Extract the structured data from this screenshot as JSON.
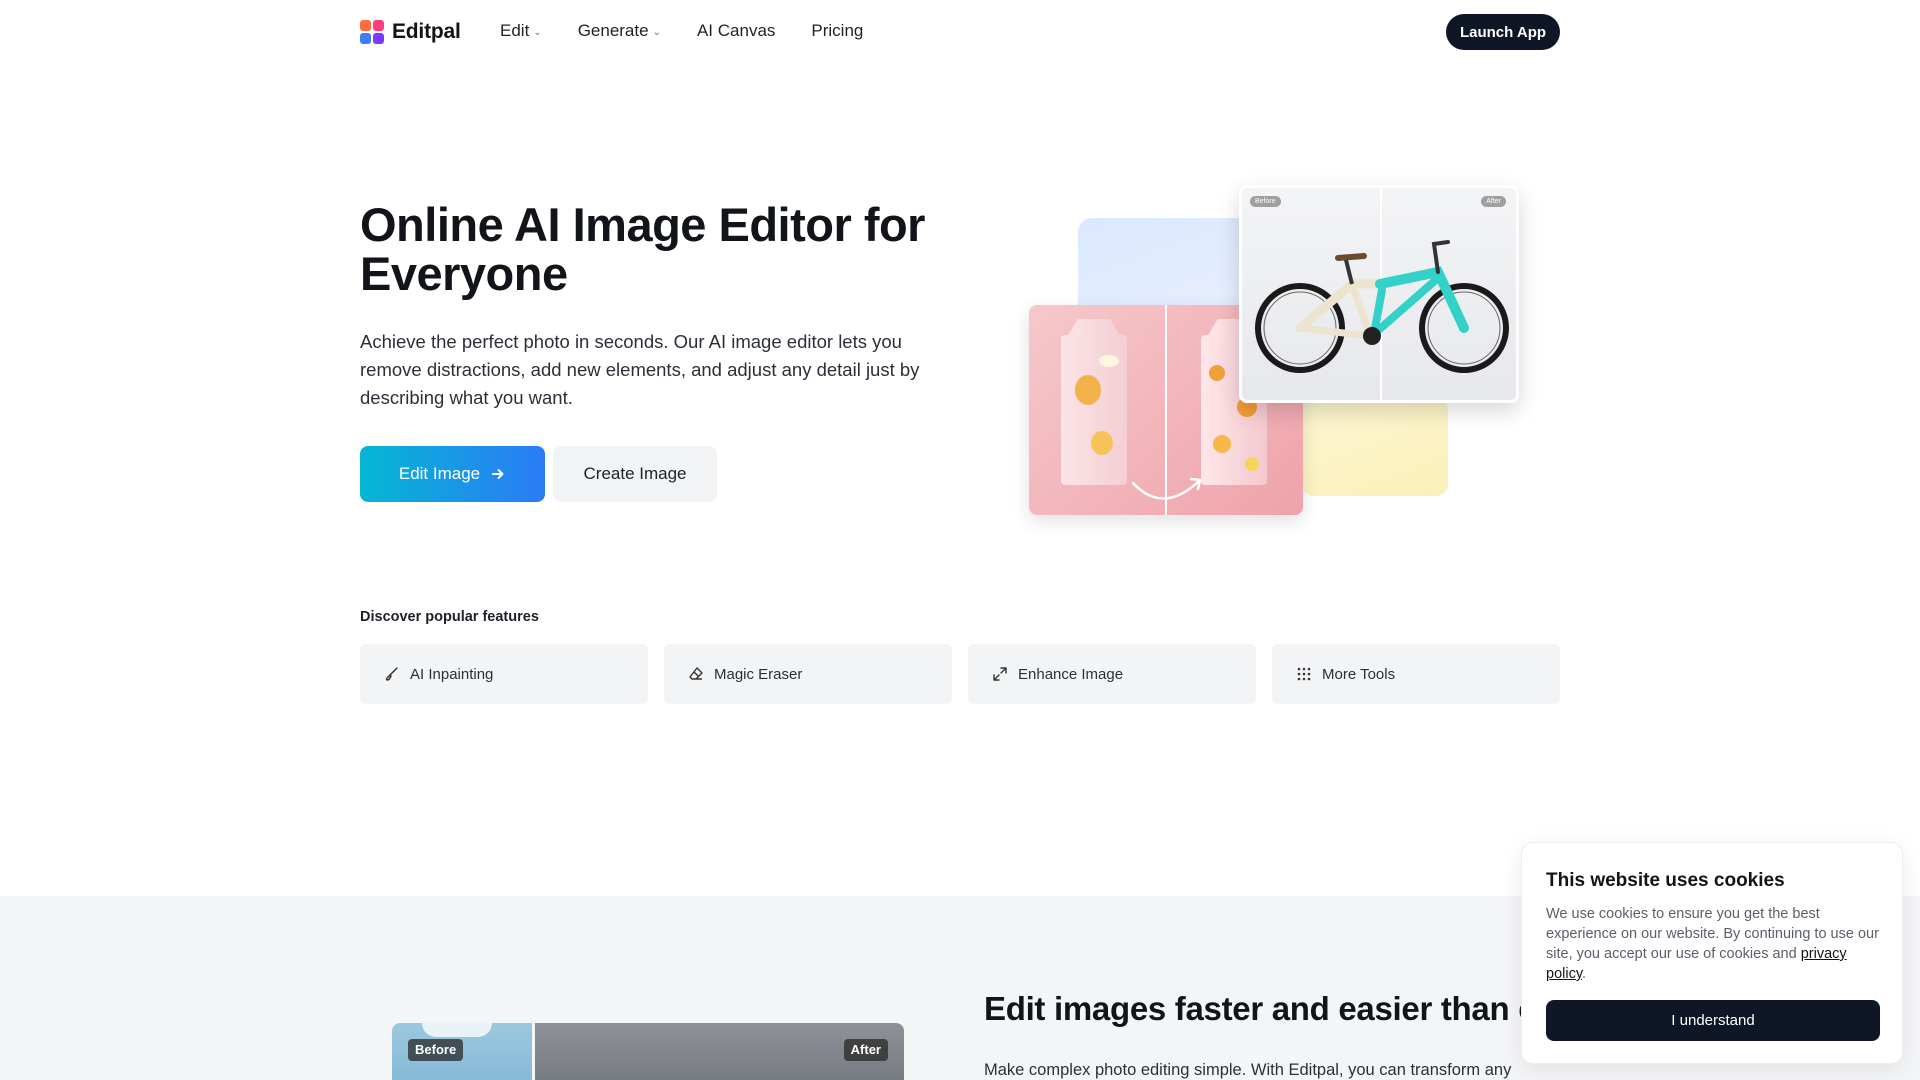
{
  "nav": {
    "brand": "Editpal",
    "links": [
      {
        "label": "Edit",
        "icon": "chevron-down-icon"
      },
      {
        "label": "Generate",
        "icon": "chevron-down-icon"
      },
      {
        "label": "AI Canvas"
      },
      {
        "label": "Pricing"
      }
    ],
    "launch_label": "Launch App"
  },
  "hero": {
    "title": "Online AI Image Editor for Everyone",
    "subtitle": "Achieve the perfect photo in seconds. Our AI image editor lets you remove distractions, add new elements, and adjust any detail just by describing what you want.",
    "edit_button": "Edit Image",
    "create_button": "Create Image",
    "bike_before": "Before",
    "bike_after": "After"
  },
  "features": {
    "title": "Discover popular features",
    "items": [
      {
        "label": "AI Inpainting",
        "icon": "brush-icon"
      },
      {
        "label": "Magic Eraser",
        "icon": "eraser-icon"
      },
      {
        "label": "Enhance Image",
        "icon": "expand-icon"
      },
      {
        "label": "More Tools",
        "icon": "grid-icon"
      }
    ]
  },
  "section2": {
    "before_label": "Before",
    "after_label": "After",
    "title": "Edit images faster and easier than ev",
    "text": "Make complex photo editing simple. With Editpal, you can transform any"
  },
  "cookie": {
    "title": "This website uses cookies",
    "text": "We use cookies to ensure you get the best experience on our website. By continuing to use our site, you accept our use of cookies and",
    "link": "privacy policy",
    "button": "I understand"
  },
  "colors": {
    "accent_start": "#06b6d4",
    "accent_end": "#2b7bf5",
    "dark": "#0f1626"
  }
}
